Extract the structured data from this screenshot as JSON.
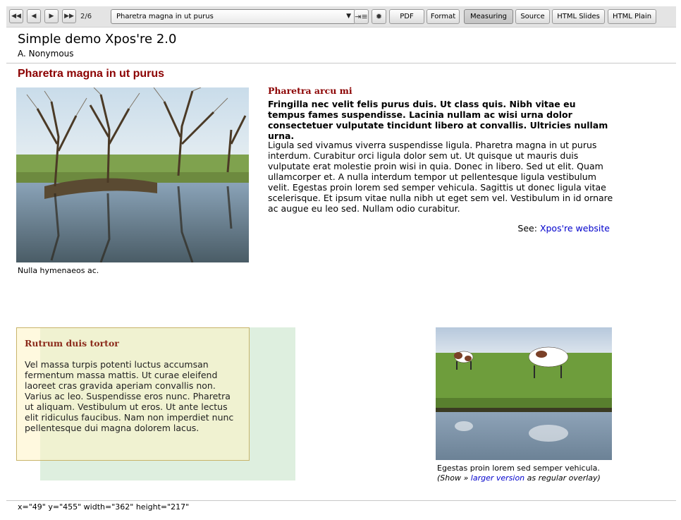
{
  "toolbar": {
    "first_icon": "first-slide-icon",
    "prev_icon": "previous-slide-icon",
    "next_icon": "next-slide-icon",
    "last_icon": "last-slide-icon",
    "slide_counter": "2/6",
    "slide_select_value": "Pharetra magna in ut purus",
    "outline_icon": "outline-toggle-icon",
    "settings_icon": "gear-icon",
    "buttons": [
      "PDF",
      "Format",
      "Measuring",
      "Source",
      "HTML Slides",
      "HTML Plain"
    ],
    "pressed_button": "Measuring"
  },
  "document": {
    "title": "Simple demo Xpos're 2.0",
    "author": "A. Nonymous"
  },
  "slide": {
    "title": "Pharetra magna in ut purus",
    "photo1_caption": "Nulla hymenaeos ac.",
    "section_heading": "Pharetra arcu mi",
    "lead": "Fringilla nec velit felis purus duis. Ut class quis. Nibh vitae eu tempus fames suspendisse. Lacinia nullam ac wisi urna dolor consectetuer vulputate tincidunt libero at convallis. Ultricies nullam urna.",
    "body": "Ligula sed vivamus viverra suspendisse ligula. Pharetra magna in ut purus interdum. Curabitur orci ligula dolor sem ut. Ut quisque ut mauris duis vulputate erat molestie proin wisi in quia. Donec in libero. Sed ut elit. Quam ullamcorper et. A nulla interdum tempor ut pellentesque ligula vestibulum velit. Egestas proin lorem sed semper vehicula. Sagittis ut donec ligula vitae scelerisque. Et ipsum vitae nulla nibh ut eget sem vel. Vestibulum in id ornare ac augue eu leo sed. Nullam odio curabitur.",
    "see_label": "See:",
    "see_link": "Xpos're website",
    "box_heading": "Rutrum duis tortor",
    "box_text": "Vel massa turpis potenti luctus accumsan fermentum massa mattis. Ut curae eleifend laoreet cras gravida aperiam convallis non. Varius ac leo. Suspendisse eros nunc. Pharetra ut aliquam. Vestibulum ut eros. Ut ante lectus elit ridiculus faucibus. Nam non imperdiet nunc pellentesque dui magna dolorem lacus.",
    "photo2_caption": "Egestas proin lorem sed semper vehicula.",
    "photo2_note_open": "(Show »",
    "photo2_note_link": "larger version",
    "photo2_note_close": "as regular overlay)"
  },
  "status_bar": {
    "measurement": "x=\"49\" y=\"455\" width=\"362\" height=\"217\""
  },
  "colors": {
    "slide_title": "#8b0000",
    "link": "#0000cc",
    "overlay_green": "#dceedd",
    "overlay_yellow": "#fff4c4"
  }
}
